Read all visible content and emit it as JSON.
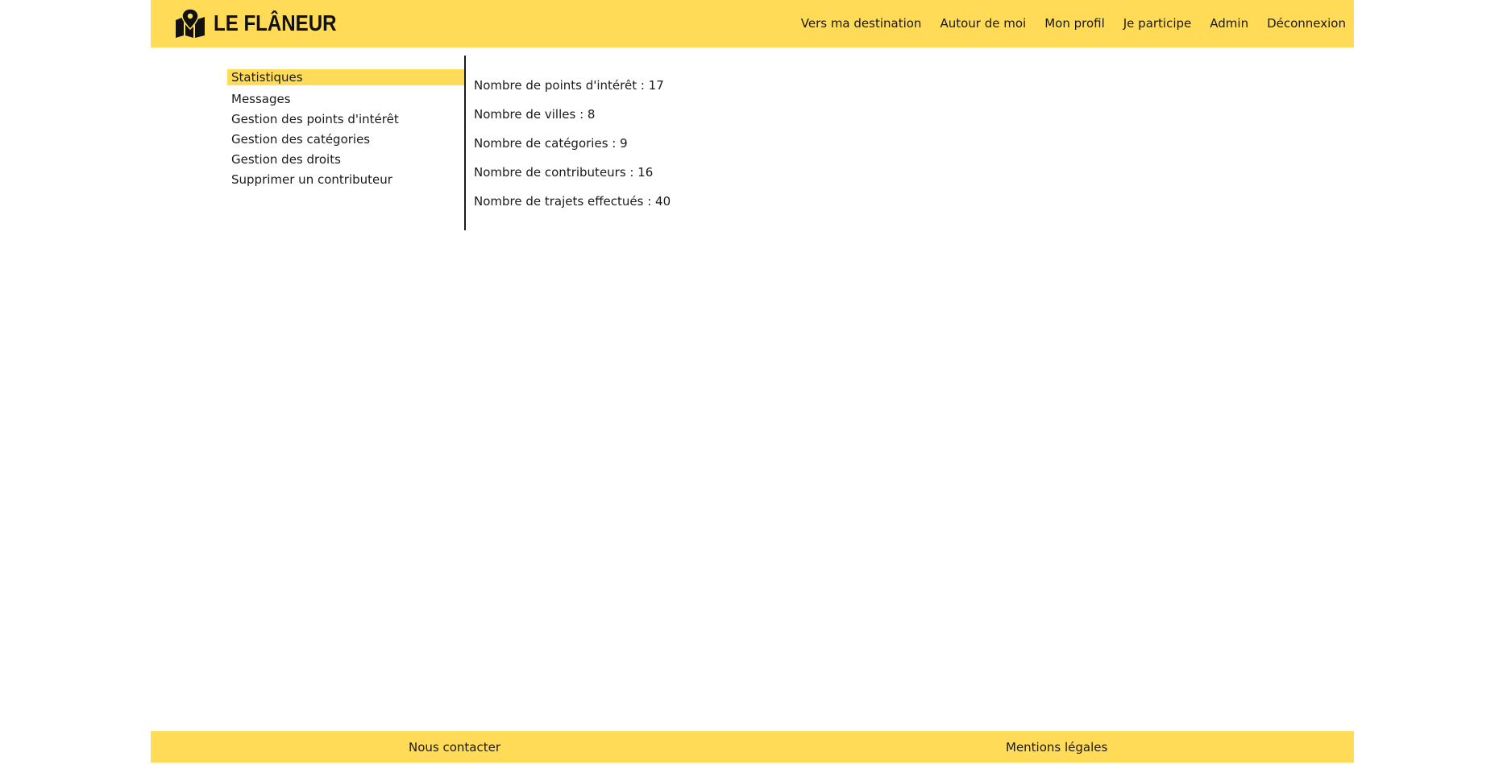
{
  "header": {
    "brand": "LE FLÂNEUR",
    "logo_icon": "map-pin-icon",
    "background": "#ffdb58",
    "nav": [
      {
        "label": "Vers ma destination"
      },
      {
        "label": "Autour de moi"
      },
      {
        "label": "Mon profil"
      },
      {
        "label": "Je participe"
      },
      {
        "label": "Admin"
      },
      {
        "label": "Déconnexion"
      }
    ]
  },
  "sidebar": {
    "items": [
      {
        "label": "Statistiques",
        "active": true
      },
      {
        "label": "Messages"
      },
      {
        "label": "Gestion des points d'intérêt"
      },
      {
        "label": "Gestion des catégories"
      },
      {
        "label": "Gestion des droits"
      },
      {
        "label": "Supprimer un contributeur"
      }
    ]
  },
  "stats": [
    {
      "text": "Nombre de points d'intérêt : 17"
    },
    {
      "text": "Nombre de villes : 8"
    },
    {
      "text": "Nombre de catégories : 9"
    },
    {
      "text": "Nombre de contributeurs : 16"
    },
    {
      "text": "Nombre de trajets effectués : 40"
    }
  ],
  "footer": {
    "contact": "Nous contacter",
    "legal": "Mentions légales"
  }
}
